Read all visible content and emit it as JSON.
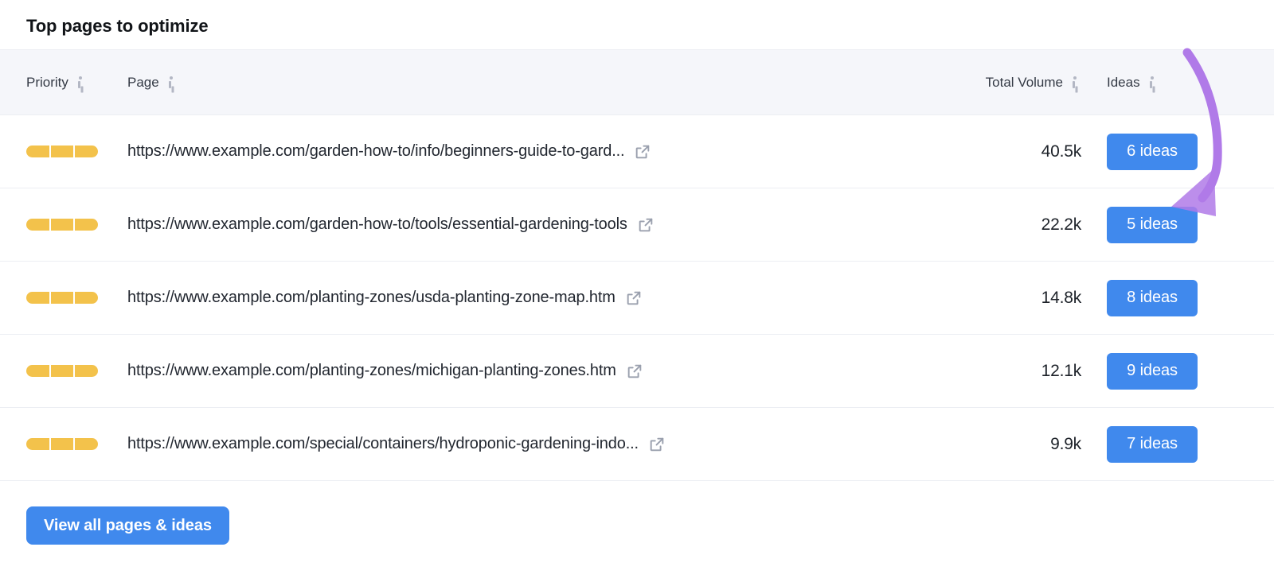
{
  "panel": {
    "title": "Top pages to optimize"
  },
  "table": {
    "columns": [
      {
        "key": "priority",
        "label": "Priority",
        "info_icon": "info-icon"
      },
      {
        "key": "page",
        "label": "Page",
        "info_icon": "info-icon"
      },
      {
        "key": "total_volume",
        "label": "Total Volume",
        "info_icon": "info-icon"
      },
      {
        "key": "ideas",
        "label": "Ideas",
        "info_icon": "info-icon"
      }
    ],
    "rows": [
      {
        "priority_filled": 3,
        "priority_total": 3,
        "url": "https://www.example.com/garden-how-to/info/beginners-guide-to-gard...",
        "link_icon": "external-link-icon",
        "total_volume": "40.5k",
        "ideas": "6 ideas"
      },
      {
        "priority_filled": 3,
        "priority_total": 3,
        "url": "https://www.example.com/garden-how-to/tools/essential-gardening-tools",
        "link_icon": "external-link-icon",
        "total_volume": "22.2k",
        "ideas": "5 ideas"
      },
      {
        "priority_filled": 3,
        "priority_total": 3,
        "url": "https://www.example.com/planting-zones/usda-planting-zone-map.htm",
        "link_icon": "external-link-icon",
        "total_volume": "14.8k",
        "ideas": "8 ideas"
      },
      {
        "priority_filled": 3,
        "priority_total": 3,
        "url": "https://www.example.com/planting-zones/michigan-planting-zones.htm",
        "link_icon": "external-link-icon",
        "total_volume": "12.1k",
        "ideas": "9 ideas"
      },
      {
        "priority_filled": 3,
        "priority_total": 3,
        "url": "https://www.example.com/special/containers/hydroponic-gardening-indo...",
        "link_icon": "external-link-icon",
        "total_volume": "9.9k",
        "ideas": "7 ideas"
      }
    ]
  },
  "footer": {
    "view_all_label": "View all pages & ideas"
  },
  "annotation": {
    "type": "curved-arrow",
    "points_to": "5 ideas",
    "color": "#b07ae8"
  },
  "colors": {
    "accent_blue": "#4089ed",
    "priority_amber": "#f3c24b",
    "header_bg": "#f5f6fa",
    "divider": "#eceef3",
    "annotation_purple": "#b07ae8"
  }
}
